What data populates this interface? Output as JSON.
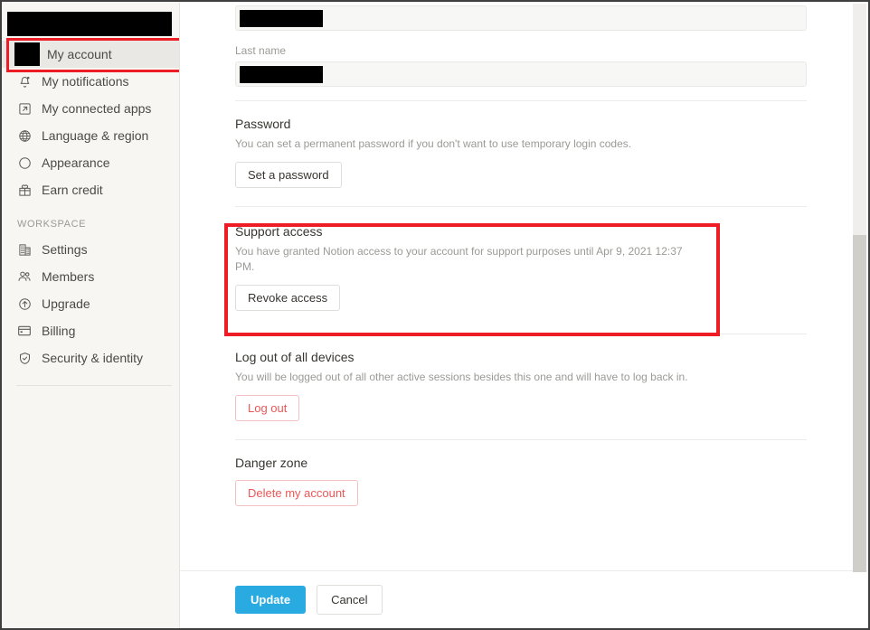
{
  "sidebar": {
    "account_redacted": true,
    "account_items": [
      {
        "label": "My account",
        "icon": "avatar-redacted",
        "selected": true
      },
      {
        "label": "My notifications",
        "icon": "bell-icon",
        "selected": false
      },
      {
        "label": "My connected apps",
        "icon": "external-link-icon",
        "selected": false
      },
      {
        "label": "Language & region",
        "icon": "globe-icon",
        "selected": false
      },
      {
        "label": "Appearance",
        "icon": "moon-icon",
        "selected": false
      },
      {
        "label": "Earn credit",
        "icon": "gift-icon",
        "selected": false
      }
    ],
    "workspace_heading": "WORKSPACE",
    "workspace_items": [
      {
        "label": "Settings",
        "icon": "building-icon"
      },
      {
        "label": "Members",
        "icon": "people-icon"
      },
      {
        "label": "Upgrade",
        "icon": "arrow-up-circle-icon"
      },
      {
        "label": "Billing",
        "icon": "credit-card-icon"
      },
      {
        "label": "Security & identity",
        "icon": "shield-check-icon"
      }
    ]
  },
  "main": {
    "first_name_value_redacted": true,
    "last_name": {
      "label": "Last name",
      "value_redacted": true
    },
    "password": {
      "title": "Password",
      "description": "You can set a permanent password if you don't want to use temporary login codes.",
      "button": "Set a password"
    },
    "support_access": {
      "title": "Support access",
      "description": "You have granted Notion access to your account for support purposes until Apr 9, 2021 12:37 PM.",
      "button": "Revoke access"
    },
    "log_out_all": {
      "title": "Log out of all devices",
      "description": "You will be logged out of all other active sessions besides this one and will have to log back in.",
      "button": "Log out"
    },
    "danger_zone": {
      "title": "Danger zone",
      "button": "Delete my account"
    }
  },
  "footer": {
    "update_label": "Update",
    "cancel_label": "Cancel"
  },
  "colors": {
    "highlight": "#ee1c25",
    "primary": "#29abe2",
    "danger": "#eb5757",
    "sidebar_bg": "#f7f6f3"
  }
}
